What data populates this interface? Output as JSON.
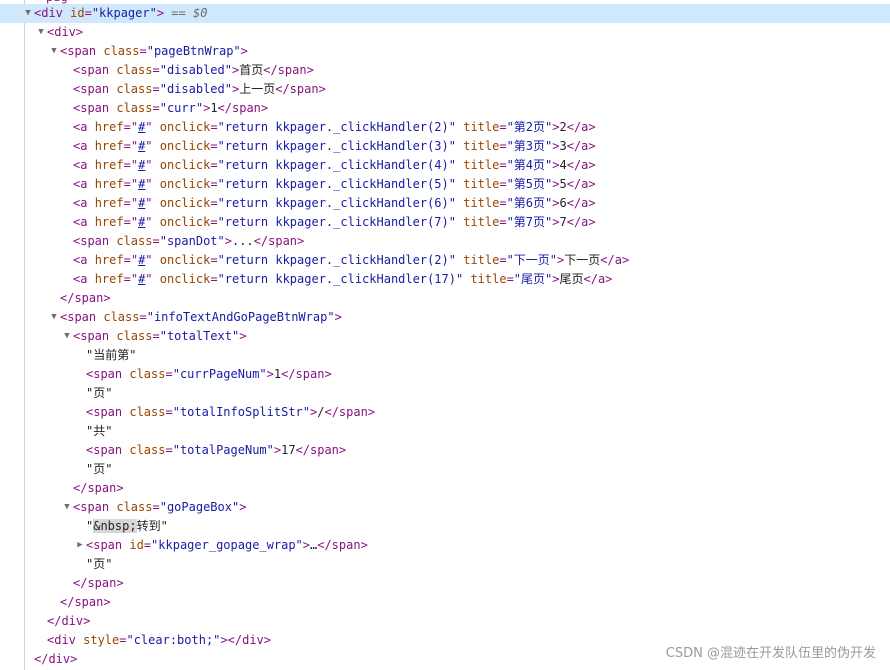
{
  "partial_line": "pag",
  "tree": [
    {
      "depth": 0,
      "triangle": "open",
      "selected": true,
      "parts": [
        {
          "t": "tag",
          "v": "<div "
        },
        {
          "t": "attr",
          "v": "id"
        },
        {
          "t": "tag",
          "v": "="
        },
        {
          "t": "val",
          "v": "\"kkpager\""
        },
        {
          "t": "tag",
          "v": ">"
        },
        {
          "t": "eqv",
          "v": " == "
        },
        {
          "t": "var",
          "v": "$0"
        }
      ]
    },
    {
      "depth": 1,
      "triangle": "open",
      "parts": [
        {
          "t": "tag",
          "v": "<div>"
        }
      ]
    },
    {
      "depth": 2,
      "triangle": "open",
      "parts": [
        {
          "t": "tag",
          "v": "<span "
        },
        {
          "t": "attr",
          "v": "class"
        },
        {
          "t": "tag",
          "v": "="
        },
        {
          "t": "val",
          "v": "\"pageBtnWrap\""
        },
        {
          "t": "tag",
          "v": ">"
        }
      ]
    },
    {
      "depth": 3,
      "parts": [
        {
          "t": "tag",
          "v": "<span "
        },
        {
          "t": "attr",
          "v": "class"
        },
        {
          "t": "tag",
          "v": "="
        },
        {
          "t": "val",
          "v": "\"disabled\""
        },
        {
          "t": "tag",
          "v": ">"
        },
        {
          "t": "txt",
          "v": "首页"
        },
        {
          "t": "tag",
          "v": "</span>"
        }
      ]
    },
    {
      "depth": 3,
      "parts": [
        {
          "t": "tag",
          "v": "<span "
        },
        {
          "t": "attr",
          "v": "class"
        },
        {
          "t": "tag",
          "v": "="
        },
        {
          "t": "val",
          "v": "\"disabled\""
        },
        {
          "t": "tag",
          "v": ">"
        },
        {
          "t": "txt",
          "v": "上一页"
        },
        {
          "t": "tag",
          "v": "</span>"
        }
      ]
    },
    {
      "depth": 3,
      "parts": [
        {
          "t": "tag",
          "v": "<span "
        },
        {
          "t": "attr",
          "v": "class"
        },
        {
          "t": "tag",
          "v": "="
        },
        {
          "t": "val",
          "v": "\"curr\""
        },
        {
          "t": "tag",
          "v": ">"
        },
        {
          "t": "txt",
          "v": "1"
        },
        {
          "t": "tag",
          "v": "</span>"
        }
      ]
    },
    {
      "depth": 3,
      "parts": [
        {
          "t": "tag",
          "v": "<a "
        },
        {
          "t": "attr",
          "v": "href"
        },
        {
          "t": "tag",
          "v": "="
        },
        {
          "t": "tag",
          "v": "\""
        },
        {
          "t": "link",
          "v": "#"
        },
        {
          "t": "tag",
          "v": "\" "
        },
        {
          "t": "attr",
          "v": "onclick"
        },
        {
          "t": "tag",
          "v": "="
        },
        {
          "t": "val",
          "v": "\"return kkpager._clickHandler(2)\""
        },
        {
          "t": "tag",
          "v": " "
        },
        {
          "t": "attr",
          "v": "title"
        },
        {
          "t": "tag",
          "v": "="
        },
        {
          "t": "val",
          "v": "\"第2页\""
        },
        {
          "t": "tag",
          "v": ">"
        },
        {
          "t": "txt",
          "v": "2"
        },
        {
          "t": "tag",
          "v": "</a>"
        }
      ]
    },
    {
      "depth": 3,
      "parts": [
        {
          "t": "tag",
          "v": "<a "
        },
        {
          "t": "attr",
          "v": "href"
        },
        {
          "t": "tag",
          "v": "="
        },
        {
          "t": "tag",
          "v": "\""
        },
        {
          "t": "link",
          "v": "#"
        },
        {
          "t": "tag",
          "v": "\" "
        },
        {
          "t": "attr",
          "v": "onclick"
        },
        {
          "t": "tag",
          "v": "="
        },
        {
          "t": "val",
          "v": "\"return kkpager._clickHandler(3)\""
        },
        {
          "t": "tag",
          "v": " "
        },
        {
          "t": "attr",
          "v": "title"
        },
        {
          "t": "tag",
          "v": "="
        },
        {
          "t": "val",
          "v": "\"第3页\""
        },
        {
          "t": "tag",
          "v": ">"
        },
        {
          "t": "txt",
          "v": "3"
        },
        {
          "t": "tag",
          "v": "</a>"
        }
      ]
    },
    {
      "depth": 3,
      "parts": [
        {
          "t": "tag",
          "v": "<a "
        },
        {
          "t": "attr",
          "v": "href"
        },
        {
          "t": "tag",
          "v": "="
        },
        {
          "t": "tag",
          "v": "\""
        },
        {
          "t": "link",
          "v": "#"
        },
        {
          "t": "tag",
          "v": "\" "
        },
        {
          "t": "attr",
          "v": "onclick"
        },
        {
          "t": "tag",
          "v": "="
        },
        {
          "t": "val",
          "v": "\"return kkpager._clickHandler(4)\""
        },
        {
          "t": "tag",
          "v": " "
        },
        {
          "t": "attr",
          "v": "title"
        },
        {
          "t": "tag",
          "v": "="
        },
        {
          "t": "val",
          "v": "\"第4页\""
        },
        {
          "t": "tag",
          "v": ">"
        },
        {
          "t": "txt",
          "v": "4"
        },
        {
          "t": "tag",
          "v": "</a>"
        }
      ]
    },
    {
      "depth": 3,
      "parts": [
        {
          "t": "tag",
          "v": "<a "
        },
        {
          "t": "attr",
          "v": "href"
        },
        {
          "t": "tag",
          "v": "="
        },
        {
          "t": "tag",
          "v": "\""
        },
        {
          "t": "link",
          "v": "#"
        },
        {
          "t": "tag",
          "v": "\" "
        },
        {
          "t": "attr",
          "v": "onclick"
        },
        {
          "t": "tag",
          "v": "="
        },
        {
          "t": "val",
          "v": "\"return kkpager._clickHandler(5)\""
        },
        {
          "t": "tag",
          "v": " "
        },
        {
          "t": "attr",
          "v": "title"
        },
        {
          "t": "tag",
          "v": "="
        },
        {
          "t": "val",
          "v": "\"第5页\""
        },
        {
          "t": "tag",
          "v": ">"
        },
        {
          "t": "txt",
          "v": "5"
        },
        {
          "t": "tag",
          "v": "</a>"
        }
      ]
    },
    {
      "depth": 3,
      "parts": [
        {
          "t": "tag",
          "v": "<a "
        },
        {
          "t": "attr",
          "v": "href"
        },
        {
          "t": "tag",
          "v": "="
        },
        {
          "t": "tag",
          "v": "\""
        },
        {
          "t": "link",
          "v": "#"
        },
        {
          "t": "tag",
          "v": "\" "
        },
        {
          "t": "attr",
          "v": "onclick"
        },
        {
          "t": "tag",
          "v": "="
        },
        {
          "t": "val",
          "v": "\"return kkpager._clickHandler(6)\""
        },
        {
          "t": "tag",
          "v": " "
        },
        {
          "t": "attr",
          "v": "title"
        },
        {
          "t": "tag",
          "v": "="
        },
        {
          "t": "val",
          "v": "\"第6页\""
        },
        {
          "t": "tag",
          "v": ">"
        },
        {
          "t": "txt",
          "v": "6"
        },
        {
          "t": "tag",
          "v": "</a>"
        }
      ]
    },
    {
      "depth": 3,
      "parts": [
        {
          "t": "tag",
          "v": "<a "
        },
        {
          "t": "attr",
          "v": "href"
        },
        {
          "t": "tag",
          "v": "="
        },
        {
          "t": "tag",
          "v": "\""
        },
        {
          "t": "link",
          "v": "#"
        },
        {
          "t": "tag",
          "v": "\" "
        },
        {
          "t": "attr",
          "v": "onclick"
        },
        {
          "t": "tag",
          "v": "="
        },
        {
          "t": "val",
          "v": "\"return kkpager._clickHandler(7)\""
        },
        {
          "t": "tag",
          "v": " "
        },
        {
          "t": "attr",
          "v": "title"
        },
        {
          "t": "tag",
          "v": "="
        },
        {
          "t": "val",
          "v": "\"第7页\""
        },
        {
          "t": "tag",
          "v": ">"
        },
        {
          "t": "txt",
          "v": "7"
        },
        {
          "t": "tag",
          "v": "</a>"
        }
      ]
    },
    {
      "depth": 3,
      "parts": [
        {
          "t": "tag",
          "v": "<span "
        },
        {
          "t": "attr",
          "v": "class"
        },
        {
          "t": "tag",
          "v": "="
        },
        {
          "t": "val",
          "v": "\"spanDot\""
        },
        {
          "t": "tag",
          "v": ">"
        },
        {
          "t": "txt",
          "v": "..."
        },
        {
          "t": "tag",
          "v": "</span>"
        }
      ]
    },
    {
      "depth": 3,
      "parts": [
        {
          "t": "tag",
          "v": "<a "
        },
        {
          "t": "attr",
          "v": "href"
        },
        {
          "t": "tag",
          "v": "="
        },
        {
          "t": "tag",
          "v": "\""
        },
        {
          "t": "link",
          "v": "#"
        },
        {
          "t": "tag",
          "v": "\" "
        },
        {
          "t": "attr",
          "v": "onclick"
        },
        {
          "t": "tag",
          "v": "="
        },
        {
          "t": "val",
          "v": "\"return kkpager._clickHandler(2)\""
        },
        {
          "t": "tag",
          "v": " "
        },
        {
          "t": "attr",
          "v": "title"
        },
        {
          "t": "tag",
          "v": "="
        },
        {
          "t": "val",
          "v": "\"下一页\""
        },
        {
          "t": "tag",
          "v": ">"
        },
        {
          "t": "txt",
          "v": "下一页"
        },
        {
          "t": "tag",
          "v": "</a>"
        }
      ]
    },
    {
      "depth": 3,
      "parts": [
        {
          "t": "tag",
          "v": "<a "
        },
        {
          "t": "attr",
          "v": "href"
        },
        {
          "t": "tag",
          "v": "="
        },
        {
          "t": "tag",
          "v": "\""
        },
        {
          "t": "link",
          "v": "#"
        },
        {
          "t": "tag",
          "v": "\" "
        },
        {
          "t": "attr",
          "v": "onclick"
        },
        {
          "t": "tag",
          "v": "="
        },
        {
          "t": "val",
          "v": "\"return kkpager._clickHandler(17)\""
        },
        {
          "t": "tag",
          "v": " "
        },
        {
          "t": "attr",
          "v": "title"
        },
        {
          "t": "tag",
          "v": "="
        },
        {
          "t": "val",
          "v": "\"尾页\""
        },
        {
          "t": "tag",
          "v": ">"
        },
        {
          "t": "txt",
          "v": "尾页"
        },
        {
          "t": "tag",
          "v": "</a>"
        }
      ]
    },
    {
      "depth": 2,
      "parts": [
        {
          "t": "tag",
          "v": "</span>"
        }
      ]
    },
    {
      "depth": 2,
      "triangle": "open",
      "parts": [
        {
          "t": "tag",
          "v": "<span "
        },
        {
          "t": "attr",
          "v": "class"
        },
        {
          "t": "tag",
          "v": "="
        },
        {
          "t": "val",
          "v": "\"infoTextAndGoPageBtnWrap\""
        },
        {
          "t": "tag",
          "v": ">"
        }
      ]
    },
    {
      "depth": 3,
      "triangle": "open",
      "parts": [
        {
          "t": "tag",
          "v": "<span "
        },
        {
          "t": "attr",
          "v": "class"
        },
        {
          "t": "tag",
          "v": "="
        },
        {
          "t": "val",
          "v": "\"totalText\""
        },
        {
          "t": "tag",
          "v": ">"
        }
      ]
    },
    {
      "depth": 4,
      "parts": [
        {
          "t": "txt",
          "v": "\"当前第\""
        }
      ]
    },
    {
      "depth": 4,
      "parts": [
        {
          "t": "tag",
          "v": "<span "
        },
        {
          "t": "attr",
          "v": "class"
        },
        {
          "t": "tag",
          "v": "="
        },
        {
          "t": "val",
          "v": "\"currPageNum\""
        },
        {
          "t": "tag",
          "v": ">"
        },
        {
          "t": "txt",
          "v": "1"
        },
        {
          "t": "tag",
          "v": "</span>"
        }
      ]
    },
    {
      "depth": 4,
      "parts": [
        {
          "t": "txt",
          "v": "\"页\""
        }
      ]
    },
    {
      "depth": 4,
      "parts": [
        {
          "t": "tag",
          "v": "<span "
        },
        {
          "t": "attr",
          "v": "class"
        },
        {
          "t": "tag",
          "v": "="
        },
        {
          "t": "val",
          "v": "\"totalInfoSplitStr\""
        },
        {
          "t": "tag",
          "v": ">"
        },
        {
          "t": "txt",
          "v": "/"
        },
        {
          "t": "tag",
          "v": "</span>"
        }
      ]
    },
    {
      "depth": 4,
      "parts": [
        {
          "t": "txt",
          "v": "\"共\""
        }
      ]
    },
    {
      "depth": 4,
      "parts": [
        {
          "t": "tag",
          "v": "<span "
        },
        {
          "t": "attr",
          "v": "class"
        },
        {
          "t": "tag",
          "v": "="
        },
        {
          "t": "val",
          "v": "\"totalPageNum\""
        },
        {
          "t": "tag",
          "v": ">"
        },
        {
          "t": "txt",
          "v": "17"
        },
        {
          "t": "tag",
          "v": "</span>"
        }
      ]
    },
    {
      "depth": 4,
      "parts": [
        {
          "t": "txt",
          "v": "\"页\""
        }
      ]
    },
    {
      "depth": 3,
      "parts": [
        {
          "t": "tag",
          "v": "</span>"
        }
      ]
    },
    {
      "depth": 3,
      "triangle": "open",
      "parts": [
        {
          "t": "tag",
          "v": "<span "
        },
        {
          "t": "attr",
          "v": "class"
        },
        {
          "t": "tag",
          "v": "="
        },
        {
          "t": "val",
          "v": "\"goPageBox\""
        },
        {
          "t": "tag",
          "v": ">"
        }
      ]
    },
    {
      "depth": 4,
      "parts": [
        {
          "t": "txt",
          "v": "\""
        },
        {
          "t": "hl",
          "v": "&nbsp;"
        },
        {
          "t": "txt",
          "v": "转到\""
        }
      ]
    },
    {
      "depth": 4,
      "triangle": "closed",
      "parts": [
        {
          "t": "tag",
          "v": "<span "
        },
        {
          "t": "attr",
          "v": "id"
        },
        {
          "t": "tag",
          "v": "="
        },
        {
          "t": "val",
          "v": "\"kkpager_gopage_wrap\""
        },
        {
          "t": "tag",
          "v": ">"
        },
        {
          "t": "txt",
          "v": "…"
        },
        {
          "t": "tag",
          "v": "</span>"
        }
      ]
    },
    {
      "depth": 4,
      "parts": [
        {
          "t": "txt",
          "v": "\"页\""
        }
      ]
    },
    {
      "depth": 3,
      "parts": [
        {
          "t": "tag",
          "v": "</span>"
        }
      ]
    },
    {
      "depth": 2,
      "parts": [
        {
          "t": "tag",
          "v": "</span>"
        }
      ]
    },
    {
      "depth": 1,
      "parts": [
        {
          "t": "tag",
          "v": "</div>"
        }
      ]
    },
    {
      "depth": 1,
      "parts": [
        {
          "t": "tag",
          "v": "<div "
        },
        {
          "t": "attr",
          "v": "style"
        },
        {
          "t": "tag",
          "v": "="
        },
        {
          "t": "val",
          "v": "\"clear:both;\""
        },
        {
          "t": "tag",
          "v": ">"
        },
        {
          "t": "tag",
          "v": "</div>"
        }
      ]
    },
    {
      "depth": 0,
      "parts": [
        {
          "t": "tag",
          "v": "</div>"
        }
      ]
    }
  ],
  "watermark": "CSDN @混迹在开发队伍里的伪开发"
}
